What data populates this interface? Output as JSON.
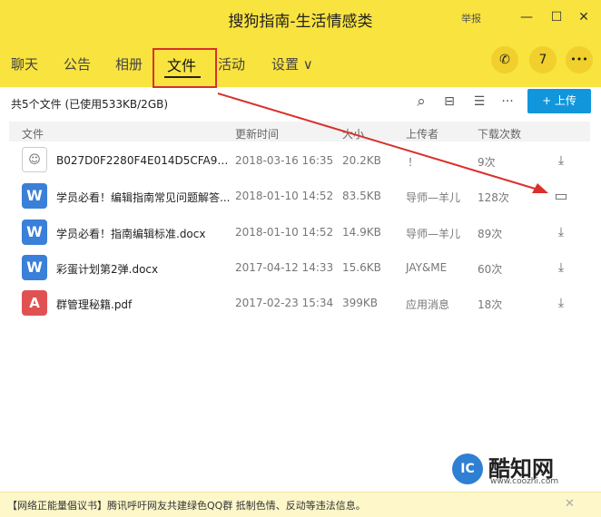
{
  "window": {
    "title": "搜狗指南-生活情感类",
    "report_label": "举报",
    "minimize_icon": "—",
    "maximize_icon": "☐",
    "close_icon": "✕"
  },
  "tabs": [
    {
      "label": "聊天"
    },
    {
      "label": "公告"
    },
    {
      "label": "相册"
    },
    {
      "label": "文件",
      "active": true
    },
    {
      "label": "活动"
    },
    {
      "label": "设置 ∨"
    }
  ],
  "toolbar": {
    "summary": "共5个文件 (已使用533KB/2GB)",
    "upload_label": "+ 上传",
    "search_icon": "⌕",
    "inbox_icon": "⊟",
    "list_icon": "☰",
    "more_icon": "···",
    "phone_icon": "✆",
    "calendar_icon": "7",
    "menu_icon": "•••"
  },
  "columns": {
    "name": "文件",
    "updated": "更新时间",
    "size": "大小",
    "uploader": "上传者",
    "downloads": "下载次数"
  },
  "files": [
    {
      "type": "img",
      "icon": "☺",
      "name": "B027D0F2280F4E014D5CFA976...",
      "updated": "2018-03-16 16:35",
      "size": "20.2KB",
      "uploader": "！",
      "downloads": "9次",
      "action_icon": "⤓"
    },
    {
      "type": "word",
      "icon": "W",
      "name": "学员必看！编辑指南常见问题解答...",
      "updated": "2018-01-10 14:52",
      "size": "83.5KB",
      "uploader": "导师—羊儿",
      "downloads": "128次",
      "action_icon": "▭"
    },
    {
      "type": "word",
      "icon": "W",
      "name": "学员必看！指南编辑标准.docx",
      "updated": "2018-01-10 14:52",
      "size": "14.9KB",
      "uploader": "导师—羊儿",
      "downloads": "89次",
      "action_icon": "⤓"
    },
    {
      "type": "word",
      "icon": "W",
      "name": "彩蛋计划第2弹.docx",
      "updated": "2017-04-12 14:33",
      "size": "15.6KB",
      "uploader": "JAY&ME",
      "downloads": "60次",
      "action_icon": "⤓"
    },
    {
      "type": "pdf",
      "icon": "A",
      "name": "群管理秘籍.pdf",
      "updated": "2017-02-23 15:34",
      "size": "399KB",
      "uploader": "应用消息",
      "downloads": "18次",
      "action_icon": "⤓"
    }
  ],
  "watermark": {
    "logo_text": "IC",
    "brand": "酷知网",
    "url": "www.coozhi.com"
  },
  "footer": {
    "text": "【网络正能量倡议书】腾讯呼吁网友共建绿色QQ群 抵制色情、反动等违法信息。",
    "close_icon": "✕"
  },
  "colors": {
    "brand_yellow": "#f9e33f",
    "upload_blue": "#1296db",
    "annotation_red": "#d9302c"
  }
}
